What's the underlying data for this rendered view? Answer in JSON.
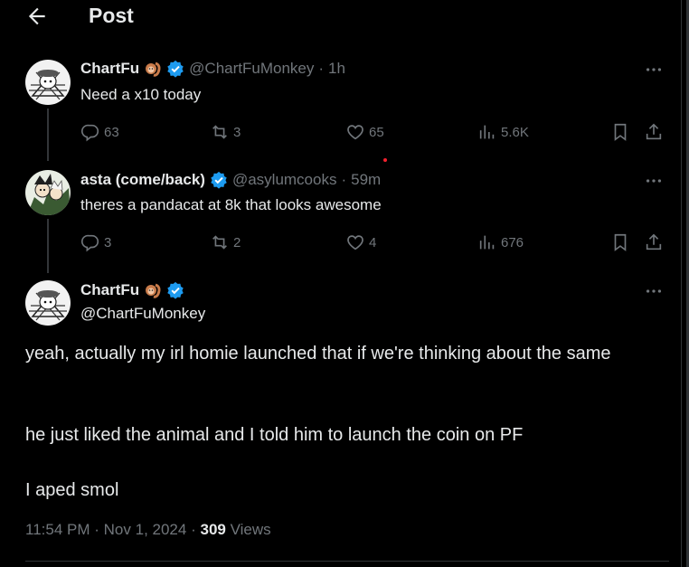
{
  "header": {
    "title": "Post"
  },
  "post1": {
    "name": "ChartFu",
    "handle": "@ChartFuMonkey",
    "separator": "·",
    "time": "1h",
    "text": "Need a x10 today",
    "replies": "63",
    "reposts": "3",
    "likes": "65",
    "views": "5.6K"
  },
  "post2": {
    "name": "asta (come/back)",
    "handle": "@asylumcooks",
    "separator": "·",
    "time": "59m",
    "text": "theres a pandacat at 8k that looks awesome",
    "replies": "3",
    "reposts": "2",
    "likes": "4",
    "views": "676"
  },
  "main": {
    "name": "ChartFu",
    "handle": "@ChartFuMonkey",
    "para1": "yeah, actually my irl homie launched that if we're thinking about the same",
    "para2": "he just liked the animal and I told him to launch the coin on PF",
    "para3": "I aped smol",
    "time": "11:54 PM",
    "date": "Nov 1, 2024",
    "separator": "·",
    "views_count": "309",
    "views_label": "Views"
  },
  "icons": {
    "back": "arrow-left-icon",
    "verified": "verified-badge-icon",
    "emoji": "monkey-emoji-icon",
    "reply": "reply-icon",
    "repost": "repost-icon",
    "like": "heart-icon",
    "views": "analytics-icon",
    "bookmark": "bookmark-icon",
    "share": "share-icon",
    "more": "more-icon"
  },
  "colors": {
    "background": "#000000",
    "text": "#e7e9ea",
    "muted": "#71767b",
    "verified": "#1d9bf0"
  }
}
